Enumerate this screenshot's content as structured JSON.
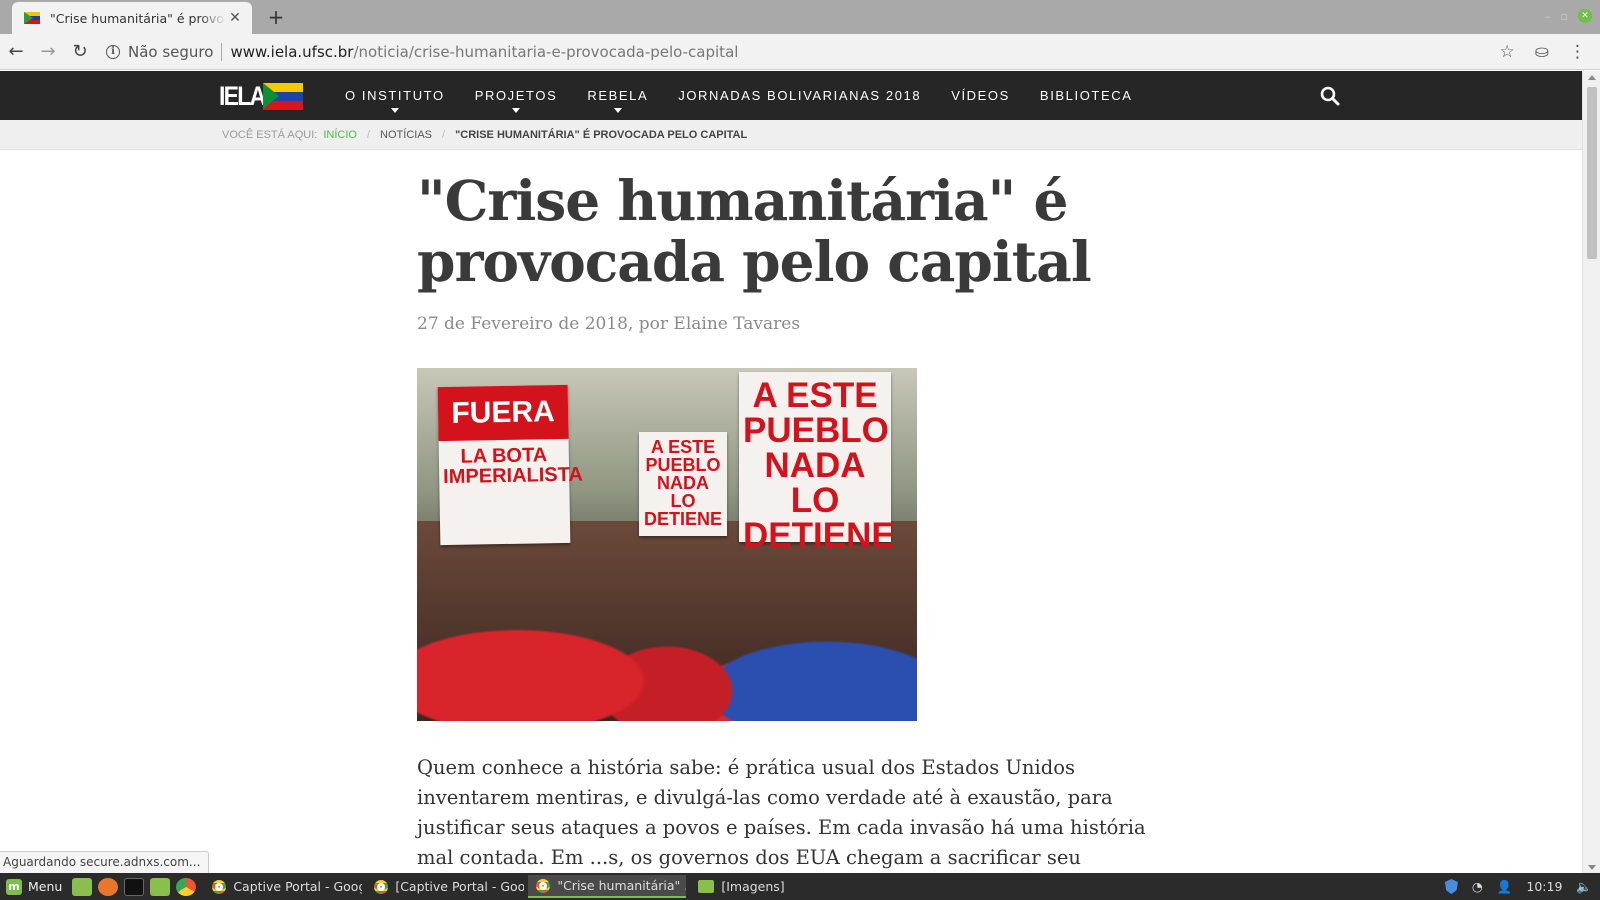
{
  "browser": {
    "tab_title": "\"Crise humanitária\" é provocada pelo capital",
    "new_tab_label": "+",
    "close_tab_label": "✕",
    "security_label": "Não seguro",
    "url_host": "www.iela.ufsc.br",
    "url_path": "/noticia/crise-humanitaria-e-provocada-pelo-capital",
    "icons": [
      "back-arrow-icon",
      "forward-arrow-icon",
      "reload-icon",
      "info-icon",
      "star-icon",
      "incognito-icon",
      "kebab-menu-icon"
    ],
    "status_text": "Aguardando secure.adnxs.com..."
  },
  "site": {
    "logo_text": "IELA",
    "nav": [
      {
        "label": "O INSTITUTO",
        "dropdown": true
      },
      {
        "label": "PROJETOS",
        "dropdown": true
      },
      {
        "label": "REBELA",
        "dropdown": true
      },
      {
        "label": "JORNADAS BOLIVARIANAS 2018",
        "dropdown": false
      },
      {
        "label": "VÍDEOS",
        "dropdown": false
      },
      {
        "label": "BIBLIOTECA",
        "dropdown": false
      }
    ],
    "breadcrumb": {
      "prefix": "VOCÊ ESTÁ AQUI:",
      "home": "INÍCIO",
      "section": "NOTÍCIAS",
      "current": "\"CRISE HUMANITÁRIA\" É PROVOCADA PELO CAPITAL"
    }
  },
  "article": {
    "title": "\"Crise humanitária\" é provocada pelo capital",
    "byline": "27 de Fevereiro de 2018, por Elaine Tavares",
    "photo_signs": {
      "sign1_top": "FUERA",
      "sign1_bottom": "LA BOTA IMPERIALISTA",
      "sign2": "A ESTE PUEBLO NADA LO DETIENE",
      "sign3": "A ESTE PUEBLO NADA LO DETIENE"
    },
    "body": "Quem conhece a história sabe: é prática usual dos Estados Unidos inventarem mentiras, e divulgá-las como verdade até à exaustão, para justificar seus ataques a povos e países. Em cada invasão há uma história mal contada. Em ...s, os governos dos EUA chegam a sacrificar seu próprio povo"
  },
  "taskbar": {
    "menu_label": "Menu",
    "tasks": [
      {
        "label": "Captive Portal - Goog...",
        "active": false,
        "icon": "chrome-icon"
      },
      {
        "label": "[Captive Portal - Goo...",
        "active": false,
        "icon": "chrome-icon"
      },
      {
        "label": "\"Crise humanitária\" ...",
        "active": true,
        "icon": "chrome-icon"
      },
      {
        "label": "[Imagens]",
        "active": false,
        "icon": "folder-icon"
      }
    ],
    "clock": "10:19"
  },
  "colors": {
    "nav_bg": "#262626",
    "breadcrumb_home": "#4fb848",
    "title": "#3a3a3a",
    "byline": "#8a8a8a"
  }
}
